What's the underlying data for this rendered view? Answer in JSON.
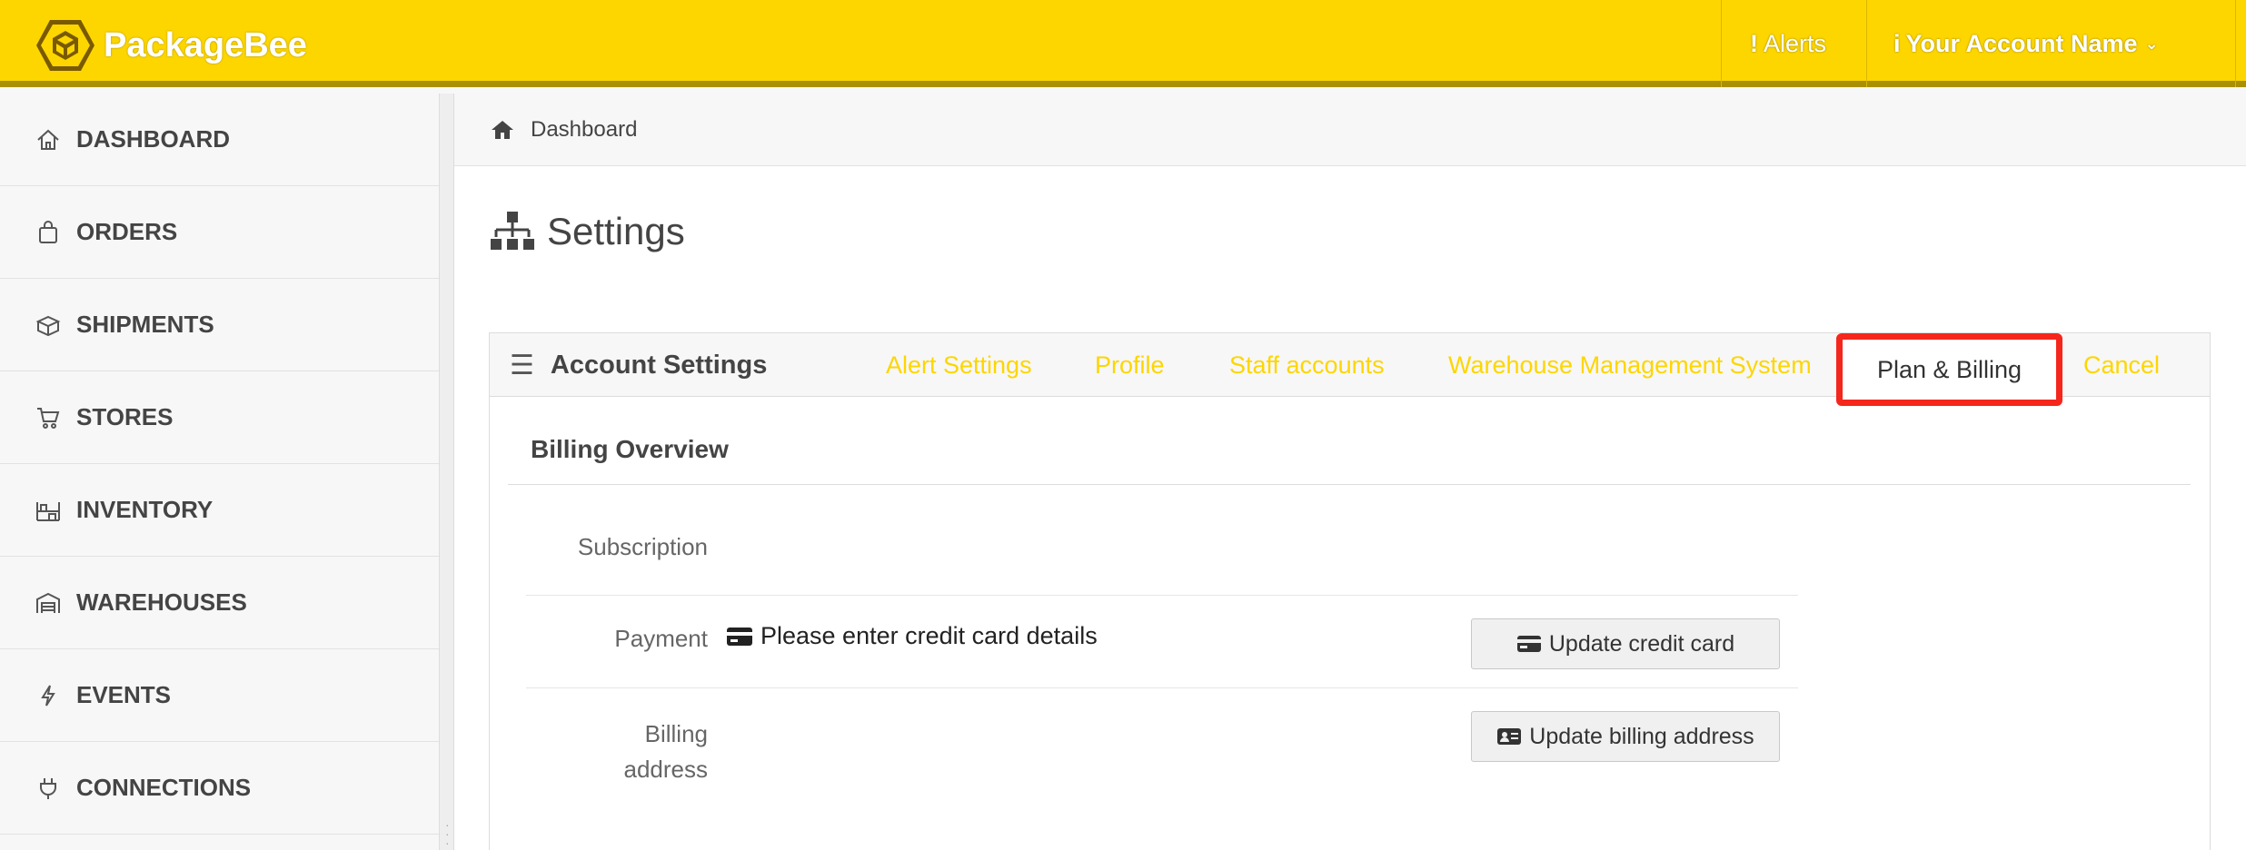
{
  "brand": {
    "name": "PackageBee"
  },
  "topbar": {
    "alerts_glyph": "!",
    "alerts_label": "Alerts",
    "account_glyph": "i",
    "account_label": "Your Account Name",
    "account_chevron": "⌄"
  },
  "sidebar": {
    "items": [
      {
        "label": "DASHBOARD",
        "icon": "home-icon"
      },
      {
        "label": "ORDERS",
        "icon": "bag-icon"
      },
      {
        "label": "SHIPMENTS",
        "icon": "box-icon"
      },
      {
        "label": "STORES",
        "icon": "cart-icon"
      },
      {
        "label": "INVENTORY",
        "icon": "shelves-icon"
      },
      {
        "label": "WAREHOUSES",
        "icon": "warehouse-icon"
      },
      {
        "label": "EVENTS",
        "icon": "bolt-icon"
      },
      {
        "label": "CONNECTIONS",
        "icon": "plug-icon"
      }
    ]
  },
  "breadcrumb": {
    "label": "Dashboard"
  },
  "page": {
    "title": "Settings"
  },
  "panel": {
    "title": "Account Settings",
    "menu_glyph": "☰",
    "tabs": [
      {
        "label": "Alert Settings"
      },
      {
        "label": "Profile"
      },
      {
        "label": "Staff accounts"
      },
      {
        "label": "Warehouse Management System"
      },
      {
        "label": "Plan & Billing",
        "active": true
      },
      {
        "label": "Cancel"
      }
    ]
  },
  "billing": {
    "section_title": "Billing Overview",
    "subscription_label": "Subscription",
    "payment_label": "Payment",
    "payment_value": "Please enter credit card details",
    "billing_label_line1": "Billing",
    "billing_label_line2": "address",
    "update_card_button": "Update credit card",
    "update_address_button": "Update billing address"
  },
  "colors": {
    "brand_yellow": "#fdd600",
    "highlight_red": "#f5261b",
    "tab_link": "#fdd600"
  }
}
